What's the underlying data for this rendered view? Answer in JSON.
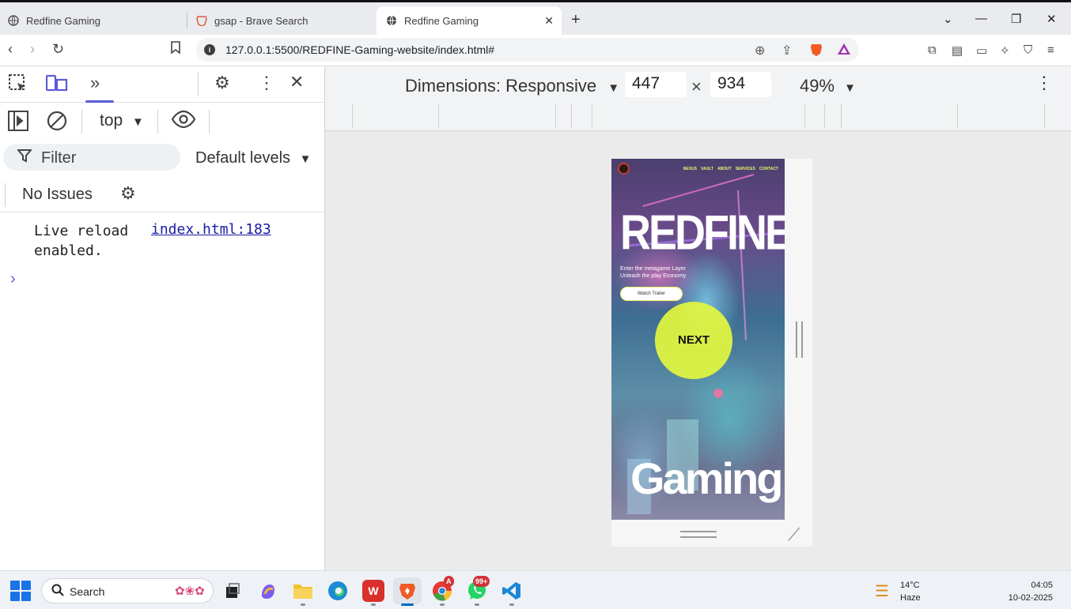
{
  "browser": {
    "tabs": [
      {
        "title": "Redfine Gaming",
        "active": false
      },
      {
        "title": "gsap - Brave Search",
        "active": false
      },
      {
        "title": "Redfine Gaming",
        "active": true
      }
    ],
    "new_tab_icon": "plus-icon",
    "url": "127.0.0.1:5500/REDFINE-Gaming-website/index.html#"
  },
  "devtools": {
    "context": "top",
    "filter_placeholder": "Filter",
    "levels": "Default levels",
    "issues": "No Issues",
    "console": {
      "message_line1": "Live reload",
      "message_line2": "enabled.",
      "source": "index.html:183"
    },
    "prompt": "›"
  },
  "device_toolbar": {
    "dimensions_label": "Dimensions: Responsive",
    "width": "447",
    "times": "×",
    "height": "934",
    "zoom": "49%"
  },
  "site": {
    "nav": [
      "NEXUS",
      "VAULT",
      "ABOUT",
      "SERVICES",
      "CONTACT"
    ],
    "hero_title": "REDFINE",
    "subtitle_line1": "Enter the metagame Layer",
    "subtitle_line2": "Unleash the play Economy",
    "button": "Watch Trailer",
    "next_label": "NEXT",
    "bottom_title": "Gaming",
    "accent_color": "#e8f56a"
  },
  "taskbar": {
    "search_label": "Search",
    "chrome_badge": "A",
    "whatsapp_badge": "99+",
    "weather_temp": "14°C",
    "weather_desc": "Haze",
    "time": "04:05",
    "date": "10-02-2025"
  }
}
